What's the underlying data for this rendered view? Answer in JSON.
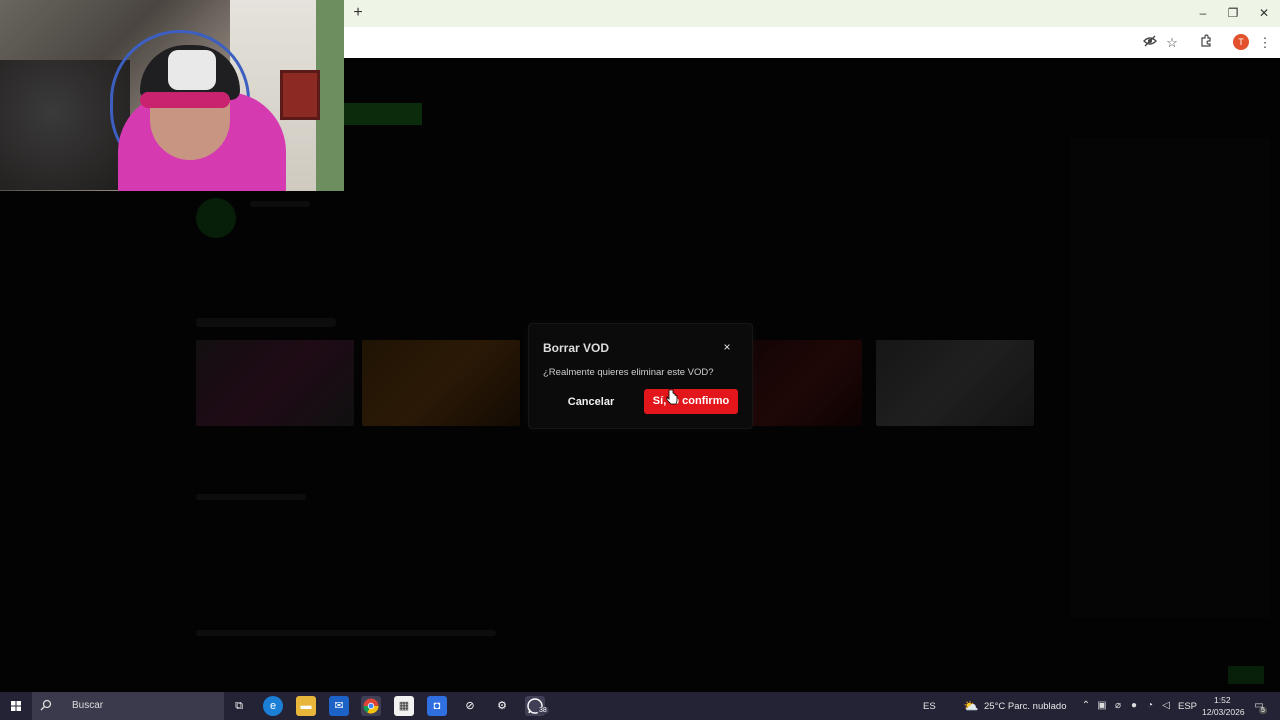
{
  "browser": {
    "new_tab": "+",
    "window_controls": {
      "minimize": "–",
      "restore": "❐",
      "close": "✕"
    },
    "toolbar_icons": [
      "eye-off-icon",
      "star-icon",
      "extensions-icon"
    ],
    "profile_initial": "T",
    "menu": "⋮"
  },
  "dialog": {
    "title": "Borrar VOD",
    "close": "×",
    "message": "¿Realmente quieres eliminar este VOD?",
    "cancel_label": "Cancelar",
    "confirm_label": "Sí, lo confirmo",
    "accent_color": "#e3161b"
  },
  "taskbar": {
    "search_placeholder": "Buscar",
    "apps": [
      "task-view-icon",
      "edge-icon",
      "file-explorer-icon",
      "mail-icon",
      "chrome-icon",
      "store-icon",
      "app-icon",
      "app2-icon",
      "settings-icon",
      "whatsapp-icon"
    ],
    "whatsapp_badge": "38",
    "language_short": "ES",
    "weather": "25°C  Parc. nublado",
    "input_lang": "ESP",
    "time": "1:52",
    "date": "12/03/2026",
    "notifications": "5"
  }
}
